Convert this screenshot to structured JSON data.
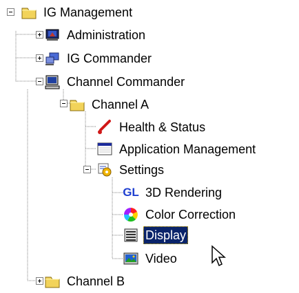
{
  "tree": {
    "root": {
      "label": "IG Management",
      "icon": "folder-icon",
      "expanded": true
    },
    "administration": {
      "label": "Administration",
      "icon": "admin-icon",
      "expanded": false
    },
    "ig_commander": {
      "label": "IG Commander",
      "icon": "ig-commander-icon",
      "expanded": false
    },
    "channel_commander": {
      "label": "Channel Commander",
      "icon": "computer-icon",
      "expanded": true
    },
    "channel_a": {
      "label": "Channel A",
      "icon": "folder-icon",
      "expanded": true
    },
    "health_status": {
      "label": "Health & Status",
      "icon": "thermometer-icon"
    },
    "application_management": {
      "label": "Application Management",
      "icon": "application-window-icon"
    },
    "settings": {
      "label": "Settings",
      "icon": "settings-icon",
      "expanded": true
    },
    "rendering_3d": {
      "label": "3D Rendering",
      "icon": "gl-icon",
      "icon_text": "GL"
    },
    "color_correction": {
      "label": "Color Correction",
      "icon": "color-wheel-icon"
    },
    "display": {
      "label": "Display",
      "icon": "display-icon",
      "selected": true
    },
    "video": {
      "label": "Video",
      "icon": "video-icon"
    },
    "channel_b": {
      "label": "Channel B",
      "icon": "folder-icon",
      "expanded": false
    }
  },
  "colors": {
    "selection_bg": "#0a246a",
    "folder": "#f2d35a",
    "gl_text": "#1e3fd0"
  }
}
